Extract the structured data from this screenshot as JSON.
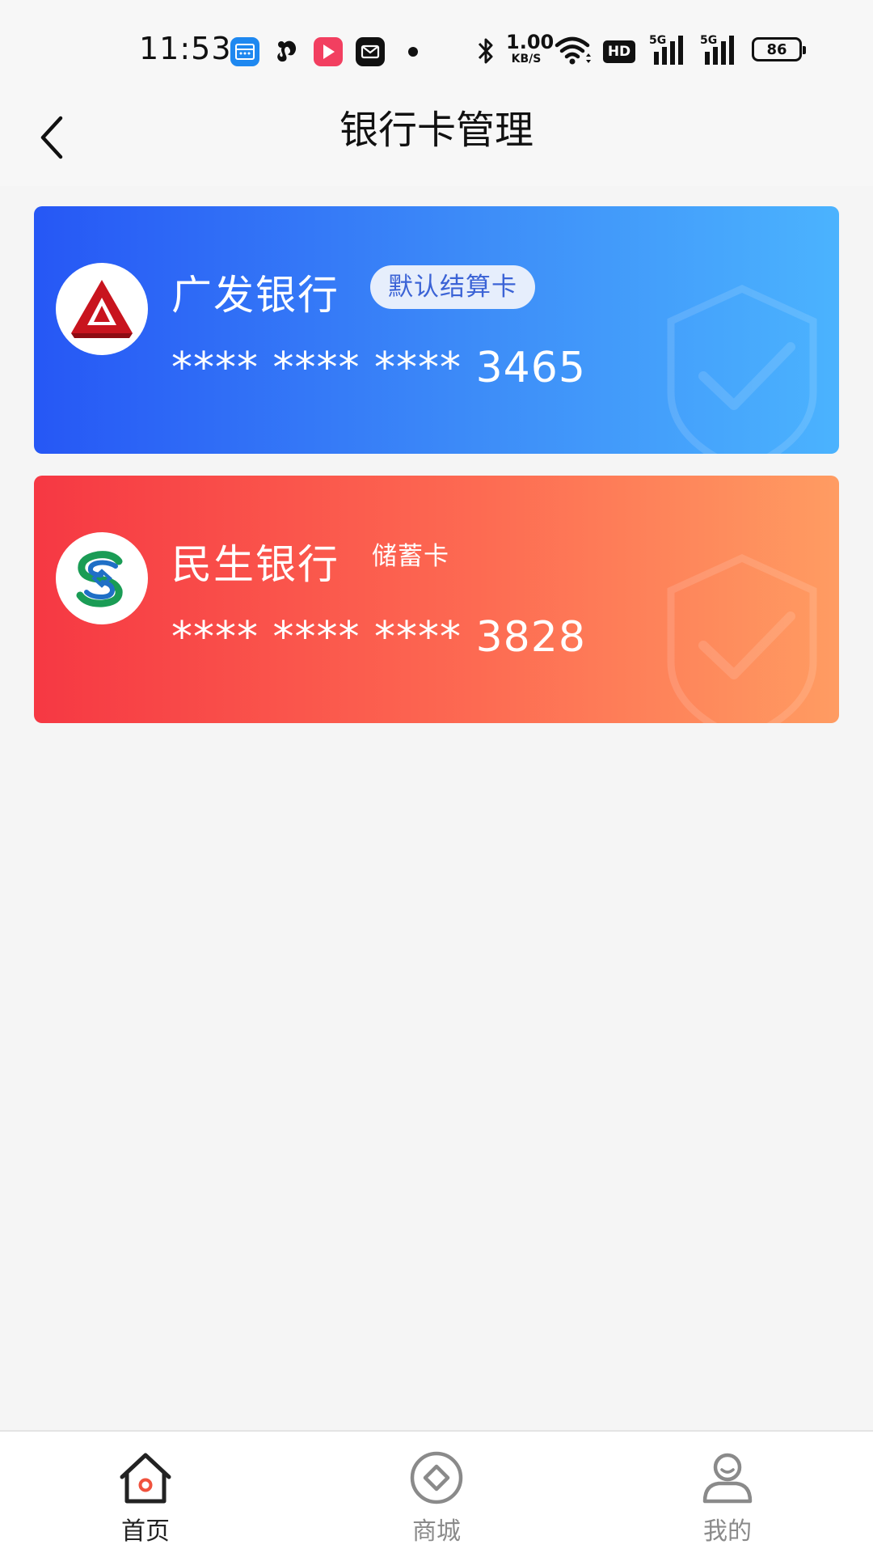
{
  "status_bar": {
    "time": "11:53",
    "net_speed_value": "1.00",
    "net_speed_unit": "KB/S",
    "hd_label": "HD",
    "signal1_label": "5G",
    "signal2_label": "5G",
    "battery_level": "86",
    "icons": [
      "calendar-app-icon",
      "squirrel-app-icon",
      "video-app-icon",
      "mail-app-icon",
      "notification-dot-icon",
      "bluetooth-icon",
      "wifi-icon",
      "hd-icon",
      "signal-icon",
      "signal-icon",
      "battery-icon"
    ]
  },
  "nav": {
    "title": "银行卡管理",
    "back_icon": "chevron-left-icon"
  },
  "cards": [
    {
      "bank_name": "广发银行",
      "tag": "默认结算卡",
      "number": "**** **** **** 3465",
      "logo_icon": "cgb-logo-icon",
      "colors": [
        "#2657f5",
        "#4bb3fe"
      ]
    },
    {
      "bank_name": "民生银行",
      "tag": "储蓄卡",
      "number": "**** **** **** 3828",
      "logo_icon": "cmbc-logo-icon",
      "colors": [
        "#f63843",
        "#ff9c62"
      ]
    }
  ],
  "tabs": [
    {
      "label": "首页",
      "icon": "home-icon",
      "active": true,
      "accent": "#f0523d"
    },
    {
      "label": "商城",
      "icon": "mall-icon",
      "active": false
    },
    {
      "label": "我的",
      "icon": "user-icon",
      "active": false
    }
  ]
}
